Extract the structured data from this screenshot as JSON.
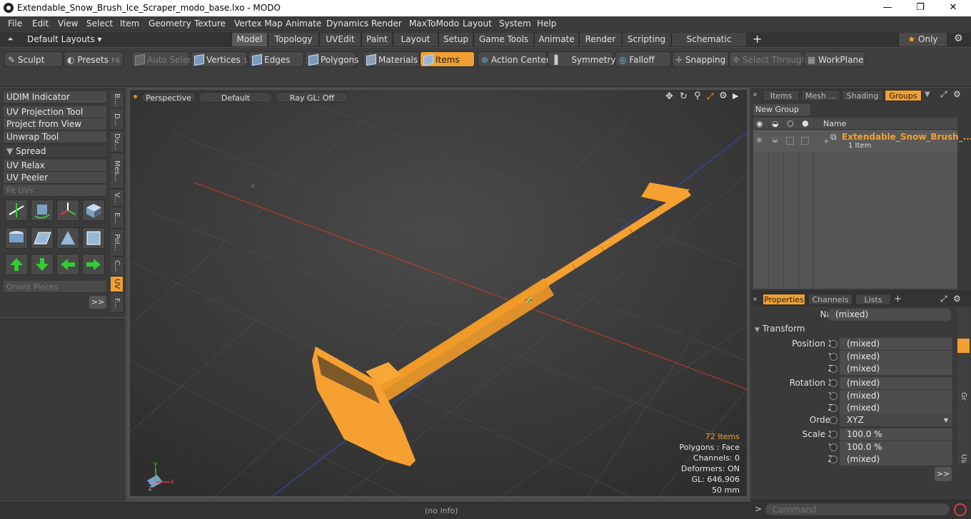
{
  "window": {
    "title": "Extendable_Snow_Brush_Ice_Scraper_modo_base.lxo - MODO",
    "minimize": "—",
    "maximize": "❐",
    "close": "✕"
  },
  "menu": [
    "File",
    "Edit",
    "View",
    "Select",
    "Item",
    "Geometry",
    "Texture",
    "Vertex Map",
    "Animate",
    "Dynamics",
    "Render",
    "MaxToModo",
    "Layout",
    "System",
    "Help"
  ],
  "layouts": {
    "selector": "Default Layouts ▾",
    "tabs": [
      "Model",
      "Topology",
      "UVEdit",
      "Paint",
      "Layout",
      "Setup",
      "Game Tools",
      "Animate",
      "Render",
      "Scripting",
      "Schematic Fusion"
    ],
    "active": "Model",
    "plus": "+",
    "only": "Only"
  },
  "toolbar": {
    "sculpt": "Sculpt",
    "presets": "Presets",
    "presets_key": "F6",
    "auto_select": "Auto Select",
    "vertices": "Vertices",
    "vertices_n": "1",
    "edges": "Edges",
    "edges_n": "2",
    "polygons": "Polygons",
    "materials": "Materials",
    "items": "Items",
    "action_center": "Action Center",
    "symmetry": "Symmetry",
    "falloff": "Falloff",
    "snapping": "Snapping",
    "select_through": "Select Through",
    "workplane": "WorkPlane"
  },
  "left": {
    "buttons": [
      "UDIM Indicator",
      "UV Projection Tool",
      "Project from View",
      "Unwrap Tool"
    ],
    "spread": "Spread",
    "buttons2": [
      "UV Relax",
      "UV Peeler",
      "Fit UVs"
    ],
    "orient": "Orient Pieces",
    "more": ">>",
    "vtabs": [
      "B...",
      "D...",
      "Du...",
      "Mes...",
      "V...",
      "E...",
      "Pol...",
      "C...",
      "UV",
      "F..."
    ]
  },
  "viewport": {
    "view": "Perspective",
    "shading": "Default",
    "raygl": "Ray GL: Off",
    "stats": {
      "items": "72 Items",
      "polygons": "Polygons : Face",
      "channels": "Channels: 0",
      "deformers": "Deformers: ON",
      "gl": "GL: 646,906",
      "scale": "50 mm"
    }
  },
  "groups": {
    "tabs": [
      "Items",
      "Mesh ...",
      "Shading",
      "Groups"
    ],
    "active": "Groups",
    "new_group": "New Group",
    "col_name": "Name",
    "row_name": "Extendable_Snow_Brush_...",
    "row_count": "1 Item"
  },
  "properties": {
    "tabs": [
      "Properties",
      "Channels",
      "Lists"
    ],
    "plus": "+",
    "name_label": "Name",
    "name_value": "(mixed)",
    "transform": "Transform",
    "rows": [
      {
        "label": "Position X",
        "value": "(mixed)"
      },
      {
        "label": "Y",
        "value": "(mixed)"
      },
      {
        "label": "Z",
        "value": "(mixed)"
      },
      {
        "label": "Rotation X",
        "value": "(mixed)"
      },
      {
        "label": "Y",
        "value": "(mixed)"
      },
      {
        "label": "Z",
        "value": "(mixed)"
      },
      {
        "label": "Order",
        "value": "XYZ"
      },
      {
        "label": "Scale X",
        "value": "100.0 %"
      },
      {
        "label": "Y",
        "value": "100.0 %"
      },
      {
        "label": "Z",
        "value": "(mixed)"
      }
    ],
    "more": ">>",
    "side_tabs": [
      "Gr",
      "Us"
    ]
  },
  "status": {
    "info": "(no info)",
    "command_placeholder": "Command",
    "prompt": ">"
  }
}
